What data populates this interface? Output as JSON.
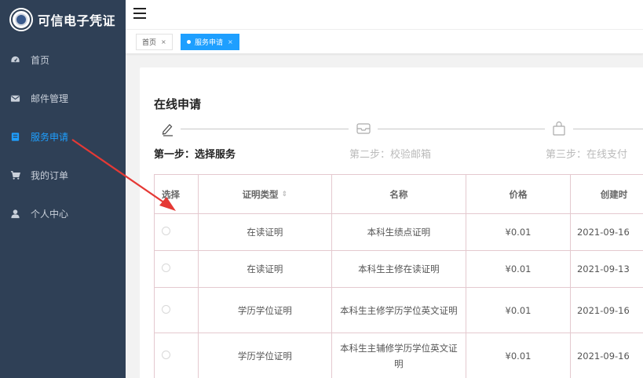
{
  "app": {
    "title": "可信电子凭证"
  },
  "sidebar": {
    "items": [
      {
        "label": "首页",
        "icon": "dashboard-icon",
        "active": false
      },
      {
        "label": "邮件管理",
        "icon": "mail-icon",
        "active": false
      },
      {
        "label": "服务申请",
        "icon": "form-icon",
        "active": true
      },
      {
        "label": "我的订单",
        "icon": "cart-icon",
        "active": false
      },
      {
        "label": "个人中心",
        "icon": "user-icon",
        "active": false
      }
    ]
  },
  "tabs": [
    {
      "label": "首页",
      "close": "×",
      "active": false
    },
    {
      "label": "服务申请",
      "close": "×",
      "active": true
    }
  ],
  "page": {
    "title": "在线申请",
    "steps": [
      {
        "label": "第一步：选择服务",
        "icon": "pencil-icon",
        "active": true
      },
      {
        "label": "第二步：校验邮箱",
        "icon": "inbox-icon",
        "active": false
      },
      {
        "label": "第三步：在线支付",
        "icon": "bag-icon",
        "active": false
      }
    ]
  },
  "table": {
    "headers": [
      "选择",
      "证明类型",
      "名称",
      "价格",
      "创建时"
    ],
    "rows": [
      {
        "type": "在读证明",
        "name": "本科生绩点证明",
        "price": "¥0.01",
        "created": "2021-09-16"
      },
      {
        "type": "在读证明",
        "name": "本科生主修在读证明",
        "price": "¥0.01",
        "created": "2021-09-13"
      },
      {
        "type": "学历学位证明",
        "name": "本科生主修学历学位英文证明",
        "price": "¥0.01",
        "created": "2021-09-16"
      },
      {
        "type": "学历学位证明",
        "name": "本科生主辅修学历学位英文证明",
        "price": "¥0.01",
        "created": "2021-09-16"
      }
    ]
  },
  "colors": {
    "sidebar_bg": "#2f4056",
    "accent": "#1e9fff",
    "annotation": "#e53935"
  }
}
